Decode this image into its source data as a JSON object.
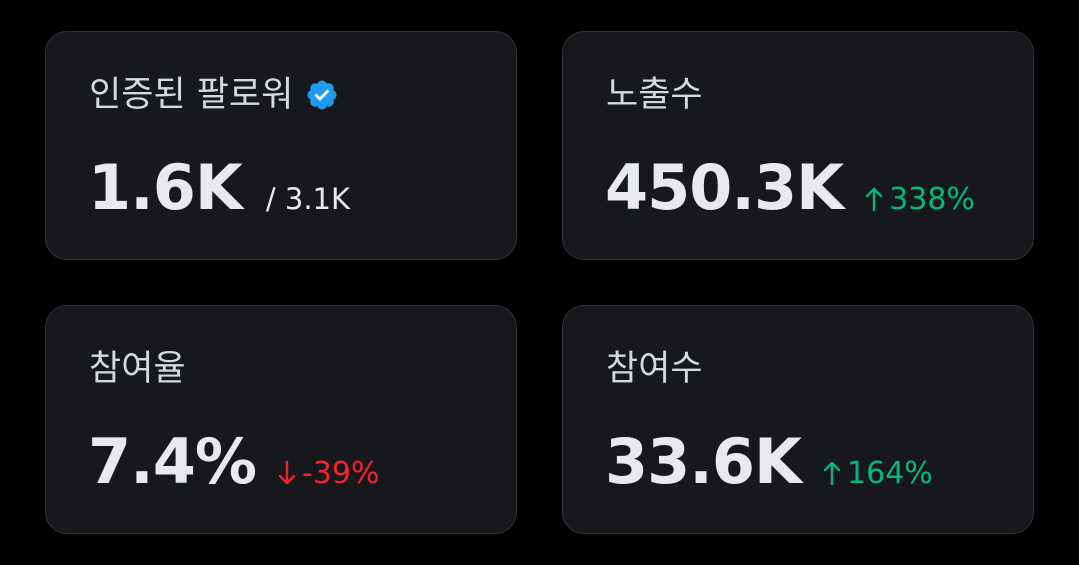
{
  "colors": {
    "background": "#000000",
    "card_background": "#16181c",
    "card_border": "#2f3336",
    "text_primary": "#e7e9ea",
    "text_secondary": "#d6d9db",
    "positive": "#00ba7c",
    "negative": "#f4212e",
    "verified_badge": "#1d9bf0"
  },
  "cards": [
    {
      "label": "인증된 팔로워",
      "value": "1.6K",
      "sub": "/ 3.1K",
      "icon": "verified-badge-icon"
    },
    {
      "label": "노출수",
      "value": "450.3K",
      "delta": "338%",
      "delta_direction": "up",
      "icon": "arrow-up-icon"
    },
    {
      "label": "참여율",
      "value": "7.4%",
      "delta": "-39%",
      "delta_direction": "down",
      "icon": "arrow-down-icon"
    },
    {
      "label": "참여수",
      "value": "33.6K",
      "delta": "164%",
      "delta_direction": "up",
      "icon": "arrow-up-icon"
    }
  ]
}
